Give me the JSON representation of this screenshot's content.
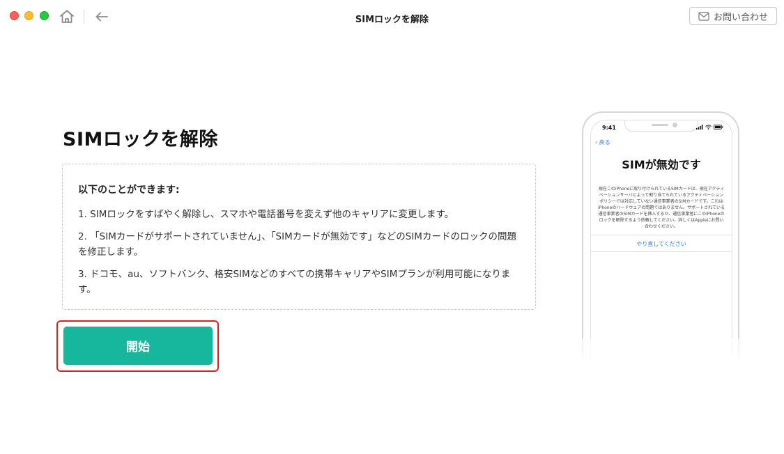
{
  "window": {
    "title": "SIMロックを解除",
    "contact_label": "お問い合わせ"
  },
  "main": {
    "title": "SIMロックを解除",
    "features_heading": "以下のことができます:",
    "features": [
      "1. SIMロックをすばやく解除し、スマホや電話番号を変えず他のキャリアに変更します。",
      "2. 「SIMカードがサポートされていません」、「SIMカードが無効です」などのSIMカードのロックの問題を修正します。",
      "3. ドコモ、au、ソフトバンク、格安SIMなどのすべての携帯キャリアやSIMプランが利用可能になります。"
    ],
    "start_label": "開始"
  },
  "phone": {
    "time": "9:41",
    "back_label": "戻る",
    "heading": "SIMが無効です",
    "message": "現在このiPhoneに取り付けられているSIMカードは、現在アクティベーションサーバによって割り当てられているアクティベーションポリシーでは対応していない通信事業者のSIMカードです。これはiPhoneのハードウェアの問題ではありません。サポートされている通信事業者のSIMカードを挿入するか、通信事業者にこのiPhoneのロックを解除するよう依頼してください。詳しくはAppleにお問い合わせください。",
    "retry_label": "やり直してください"
  },
  "colors": {
    "accent": "#17b79d",
    "highlight": "#e02020",
    "link": "#2f7cf6"
  },
  "icons": [
    "home-icon",
    "back-arrow-icon",
    "mail-icon",
    "signal-icon",
    "wifi-icon",
    "battery-icon"
  ]
}
